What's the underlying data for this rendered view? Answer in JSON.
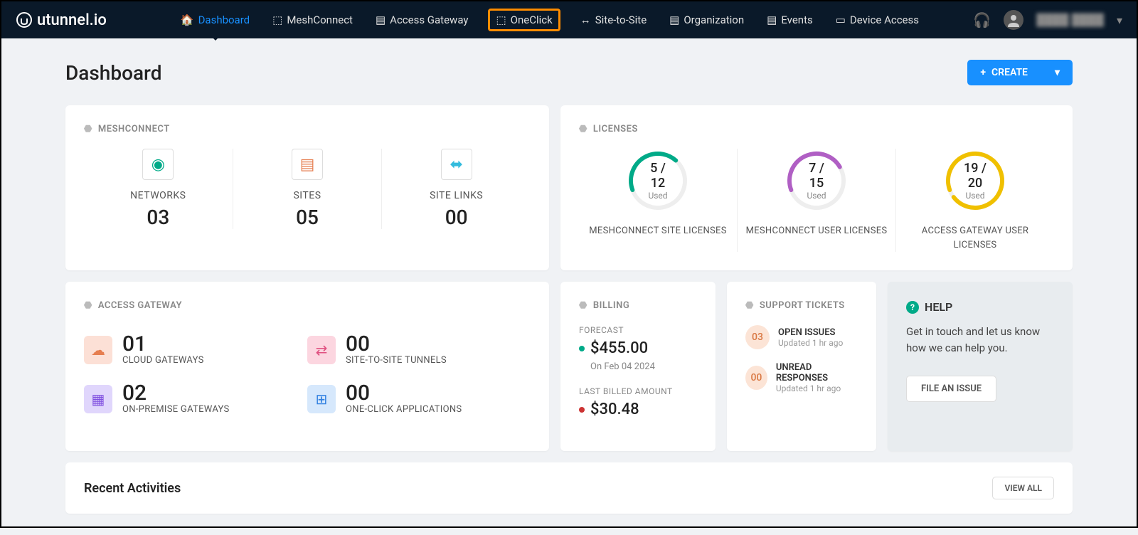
{
  "brand": "utunnel.io",
  "nav": {
    "dashboard": "Dashboard",
    "meshconnect": "MeshConnect",
    "access_gateway": "Access Gateway",
    "oneclick": "OneClick",
    "site_to_site": "Site-to-Site",
    "organization": "Organization",
    "events": "Events",
    "device_access": "Device Access"
  },
  "username": "████ ████",
  "page_title": "Dashboard",
  "create_label": "CREATE",
  "mesh": {
    "header": "MESHCONNECT",
    "items": [
      {
        "label": "NETWORKS",
        "value": "03"
      },
      {
        "label": "SITES",
        "value": "05"
      },
      {
        "label": "SITE LINKS",
        "value": "00"
      }
    ]
  },
  "licenses": {
    "header": "LICENSES",
    "used_label": "Used",
    "items": [
      {
        "value": "5 / 12",
        "label": "MESHCONNECT SITE LICENSES",
        "color": "#0a8",
        "pct": 42
      },
      {
        "value": "7 / 15",
        "label": "MESHCONNECT USER LICENSES",
        "color": "#b05fc4",
        "pct": 47
      },
      {
        "value": "19 / 20",
        "label": "ACCESS GATEWAY USER LICENSES",
        "color": "#f0c000",
        "pct": 95
      }
    ]
  },
  "access_gateway": {
    "header": "ACCESS GATEWAY",
    "items": [
      {
        "value": "01",
        "label": "CLOUD GATEWAYS",
        "bg": "#fce0d6",
        "color": "#e67e50"
      },
      {
        "value": "00",
        "label": "SITE-TO-SITE TUNNELS",
        "bg": "#fcd6e0",
        "color": "#e05080"
      },
      {
        "value": "02",
        "label": "ON-PREMISE GATEWAYS",
        "bg": "#e0d6fc",
        "color": "#8050e0"
      },
      {
        "value": "00",
        "label": "ONE-CLICK APPLICATIONS",
        "bg": "#d6e8fc",
        "color": "#3080e0"
      }
    ]
  },
  "billing": {
    "header": "BILLING",
    "forecast_label": "FORECAST",
    "forecast_value": "$455.00",
    "forecast_date": "On Feb 04 2024",
    "last_label": "LAST BILLED AMOUNT",
    "last_value": "$30.48"
  },
  "tickets": {
    "header": "SUPPORT TICKETS",
    "items": [
      {
        "count": "03",
        "title": "OPEN ISSUES",
        "sub": "Updated 1 hr ago"
      },
      {
        "count": "00",
        "title": "UNREAD RESPONSES",
        "sub": "Updated 1 hr ago"
      }
    ]
  },
  "help": {
    "title": "HELP",
    "text": "Get in touch and let us know how we can help you.",
    "button": "FILE AN ISSUE"
  },
  "recent": {
    "title": "Recent Activities",
    "viewall": "VIEW ALL"
  }
}
